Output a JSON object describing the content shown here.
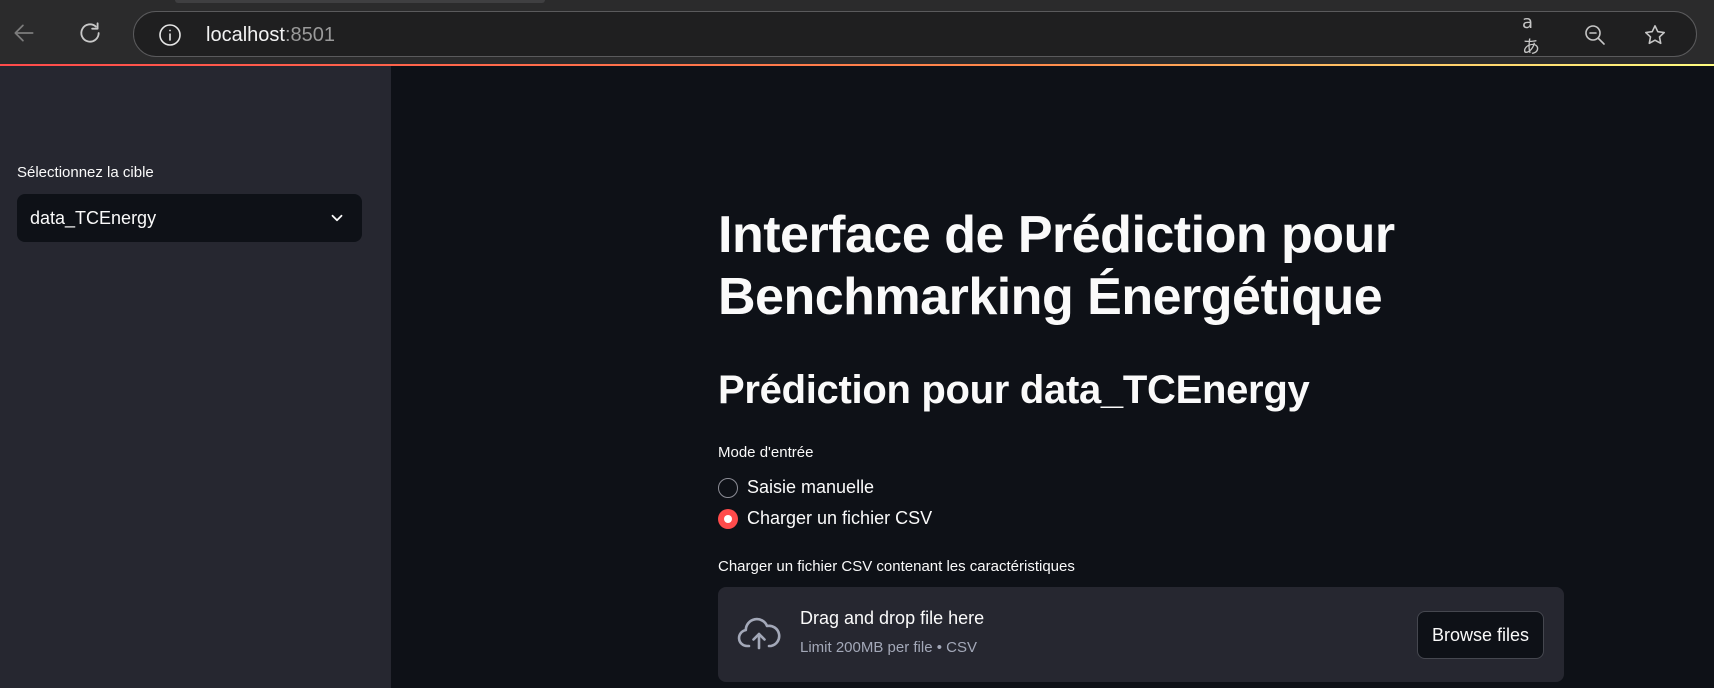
{
  "browser": {
    "url_host": "localhost",
    "url_port": ":8501",
    "icons": {
      "back": "back-arrow-icon",
      "reload": "reload-icon",
      "info": "info-icon",
      "translate": "translate-icon",
      "zoom": "zoom-out-icon",
      "favorite": "star-icon"
    },
    "translate_glyph": "aあ"
  },
  "sidebar": {
    "select_label": "Sélectionnez la cible",
    "select_value": "data_TCEnergy"
  },
  "main": {
    "title": "Interface de Prédiction pour Benchmarking Énergétique",
    "subtitle": "Prédiction pour data_TCEnergy",
    "mode": {
      "label": "Mode d'entrée",
      "options": [
        {
          "label": "Saisie manuelle",
          "selected": false
        },
        {
          "label": "Charger un fichier CSV",
          "selected": true
        }
      ]
    },
    "uploader": {
      "label": "Charger un fichier CSV contenant les caractéristiques",
      "drop_title": "Drag and drop file here",
      "limit_text": "Limit 200MB per file • CSV",
      "browse_label": "Browse files"
    }
  },
  "colors": {
    "accent": "#ff4b4b",
    "background": "#0e1117",
    "sidebar": "#262730",
    "text": "#fafafa"
  }
}
